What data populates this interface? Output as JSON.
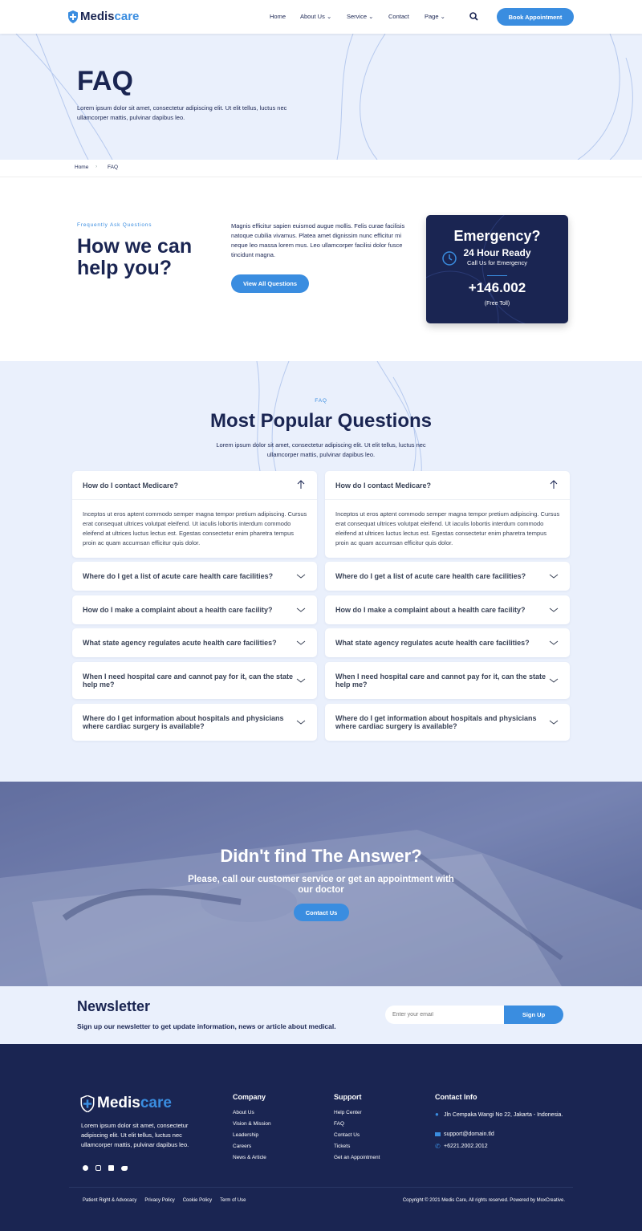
{
  "brand": {
    "part1": "Medis",
    "part2": "care",
    "icon": "shield-cross-icon",
    "accent": "#3a8de0",
    "navy": "#1a2552"
  },
  "nav": {
    "home": "Home",
    "about": "About Us",
    "service": "Service",
    "contact": "Contact",
    "page": "Page",
    "cta": "Book Appointment"
  },
  "hero": {
    "title": "FAQ",
    "text": "Lorem ipsum dolor sit amet, consectetur adipiscing elit. Ut elit tellus, luctus nec ullamcorper mattis, pulvinar dapibus leo."
  },
  "breadcrumb": {
    "home": "Home",
    "current": "FAQ"
  },
  "help": {
    "eyebrow": "Frequently Ask Questions",
    "title": "How we can help you?",
    "text": "Magnis efficitur sapien euismod augue mollis. Felis curae facilisis natoque cubilia vivamus. Platea amet dignissim nunc efficitur mi neque leo massa lorem mus. Leo ullamcorper facilisi dolor fusce tincidunt magna.",
    "button": "View All Questions"
  },
  "emergency": {
    "title": "Emergency?",
    "ready": "24 Hour Ready",
    "sub": "Call Us for Emergency",
    "number": "+146.002",
    "note": "(Free Toll)"
  },
  "faq": {
    "eyebrow": "FAQ",
    "title": "Most Popular Questions",
    "text": "Lorem ipsum dolor sit amet, consectetur adipiscing elit. Ut elit tellus, luctus nec ullamcorper mattis, pulvinar dapibus leo.",
    "answer": "Inceptos ut eros aptent commodo semper magna tempor pretium adipiscing. Cursus erat consequat ultrices volutpat eleifend. Ut iaculis lobortis interdum commodo eleifend at ultrices luctus lectus est. Egestas consectetur enim pharetra tempus proin ac quam accumsan efficitur quis dolor.",
    "left": [
      "How do I contact Medicare?",
      "Where do I get a list of acute care health care facilities?",
      "How do I make a complaint about a health care facility?",
      "What state agency regulates acute health care facilities?",
      "When I need hospital care and cannot pay for it, can the state help me?",
      "Where do I get information about hospitals and physicians where cardiac surgery is available?"
    ],
    "right": [
      "How do I contact Medicare?",
      "Where do I get a list of acute care health care facilities?",
      "How do I make a complaint about a health care facility?",
      "What state agency regulates acute health care facilities?",
      "When I need hospital care and cannot pay for it, can the state help me?",
      "Where do I get information about hospitals and physicians where cardiac surgery is available?"
    ]
  },
  "cta": {
    "title": "Didn't find The Answer?",
    "text": "Please, call our customer service or get an appointment with our doctor",
    "button": "Contact Us"
  },
  "newsletter": {
    "title": "Newsletter",
    "text": "Sign up our newsletter to get update information, news or article about medical.",
    "placeholder": "Enter your email",
    "button": "Sign Up"
  },
  "footer": {
    "about": "Lorem ipsum dolor sit amet, consectetur adipiscing elit. Ut elit tellus, luctus nec ullamcorper mattis, pulvinar dapibus leo.",
    "company": {
      "title": "Company",
      "links": [
        "About Us",
        "Vision & Mission",
        "Leadership",
        "Careers",
        "News & Article"
      ]
    },
    "support": {
      "title": "Support",
      "links": [
        "Help Center",
        "FAQ",
        "Contact Us",
        "Tickets",
        "Get an Appointment"
      ]
    },
    "contact": {
      "title": "Contact Info",
      "address": "Jln Cempaka Wangi No 22, Jakarta - Indonesia.",
      "email": "support@domain.tld",
      "phone": "+6221.2002.2012"
    },
    "social": [
      "facebook-icon",
      "instagram-icon",
      "linkedin-icon",
      "twitter-icon"
    ],
    "bottom_links": [
      "Patient Right & Advocacy",
      "Privacy Policy",
      "Cookie Policy",
      "Term of Use"
    ],
    "copyright": "Copyright © 2021 Medis Care, All rights reserved. Powered by MoxCreative."
  }
}
